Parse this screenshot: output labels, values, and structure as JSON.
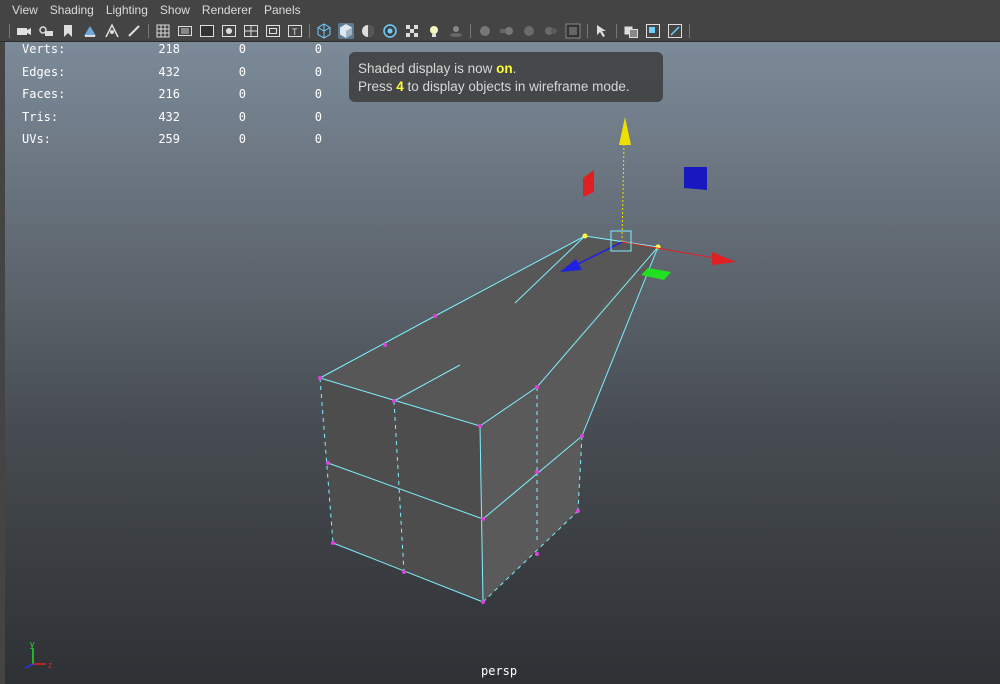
{
  "menu": [
    "View",
    "Shading",
    "Lighting",
    "Show",
    "Renderer",
    "Panels"
  ],
  "toolbar": {
    "icons": [
      "camera-icon",
      "camera-attr-icon",
      "bookmark-icon",
      "image-plane-icon",
      "grid-snap-icon",
      "pen-icon",
      "grid-icon",
      "film-gate-icon",
      "resolution-gate-icon",
      "gate-mask-icon",
      "field-chart-icon",
      "safe-title-icon",
      "wireframe-icon",
      "smooth-shade-icon",
      "default-material-icon",
      "xray-icon",
      "textured-icon",
      "light-icon",
      "shadows-icon",
      "ao-icon",
      "motion-blur-icon",
      "anti-alias-icon",
      "dof-icon",
      "isolate-select-icon",
      "xray-joints-icon",
      "two-panel-icon",
      "four-panel-icon",
      "frame-icon"
    ],
    "active": [
      "smooth-shade-icon"
    ]
  },
  "hud": {
    "rows": [
      {
        "label": "Verts:",
        "v1": "218",
        "v2": "0",
        "v3": "0"
      },
      {
        "label": "Edges:",
        "v1": "432",
        "v2": "0",
        "v3": "0"
      },
      {
        "label": "Faces:",
        "v1": "216",
        "v2": "0",
        "v3": "0"
      },
      {
        "label": "Tris:",
        "v1": "432",
        "v2": "0",
        "v3": "0"
      },
      {
        "label": "UVs:",
        "v1": "259",
        "v2": "0",
        "v3": "0"
      }
    ]
  },
  "notice": {
    "line1_pre": "Shaded display is now ",
    "line1_hl": "on",
    "line1_post": ".",
    "line2_pre": "Press ",
    "line2_hl": "4",
    "line2_post": " to display objects in wireframe mode."
  },
  "camera_label": "persp",
  "axis": {
    "y": "y",
    "z": "z",
    "x": "x"
  },
  "colors": {
    "wire": "#7ef0ff",
    "vertex": "#e040e0",
    "x_axis": "#e02020",
    "y_axis": "#f0e000",
    "z_axis": "#2020e0",
    "plane_green": "#20e020"
  }
}
